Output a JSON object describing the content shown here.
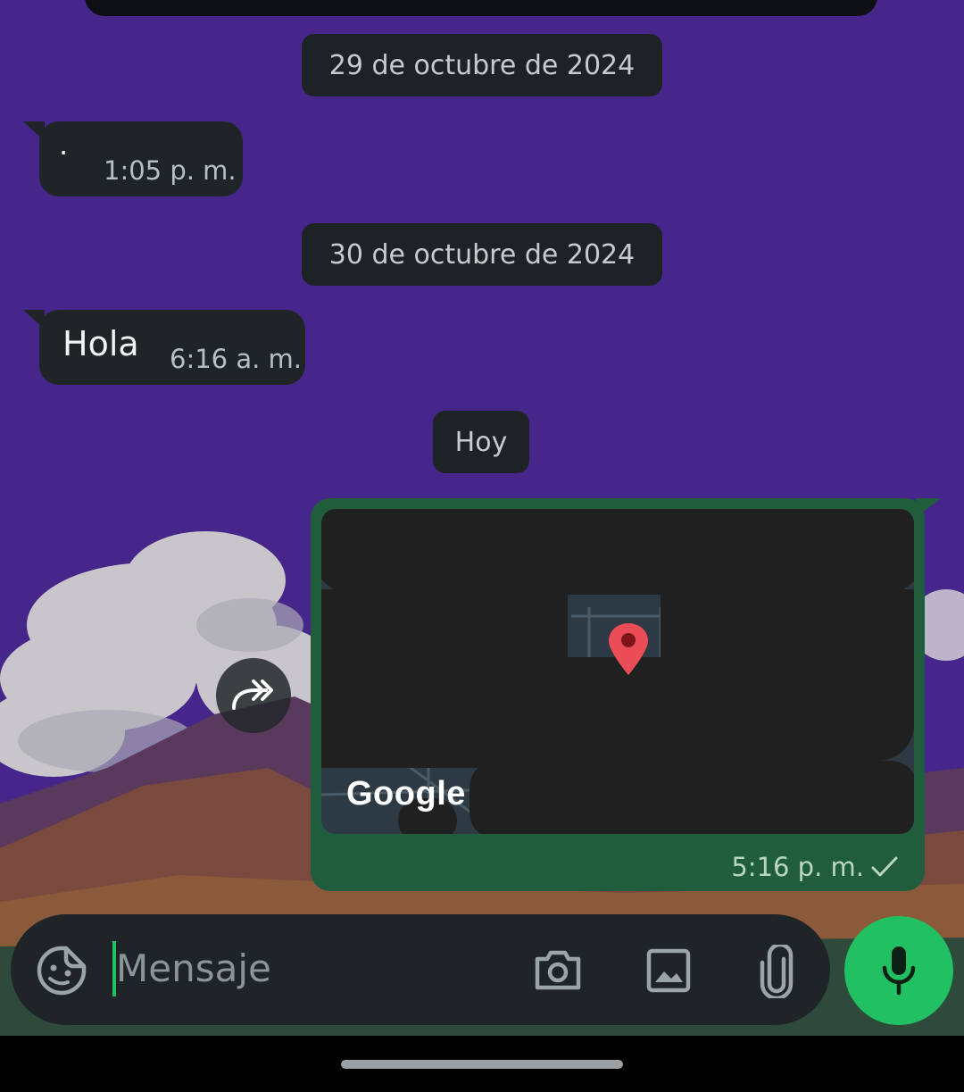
{
  "colors": {
    "wallpaper": "#46268a",
    "incoming_bubble": "#1f2527",
    "outgoing_bubble": "#1f5d3d",
    "accent": "#21c063"
  },
  "dates": {
    "first": "29 de octubre de 2024",
    "second": "30 de octubre de 2024",
    "today": "Hoy"
  },
  "messages": [
    {
      "direction": "in",
      "text": "·",
      "time": "1:05 p. m."
    },
    {
      "direction": "in",
      "text": "Hola",
      "time": "6:16 a. m."
    },
    {
      "direction": "out",
      "type": "location",
      "map_label": "Google",
      "time": "5:16 p. m.",
      "status": "sent-check-icon"
    }
  ],
  "composer": {
    "placeholder": "Mensaje",
    "icons": [
      "sticker-icon",
      "camera-icon",
      "image-icon",
      "attach-icon"
    ],
    "send_icon": "mic-icon"
  },
  "forward_icon": "forward-icon"
}
